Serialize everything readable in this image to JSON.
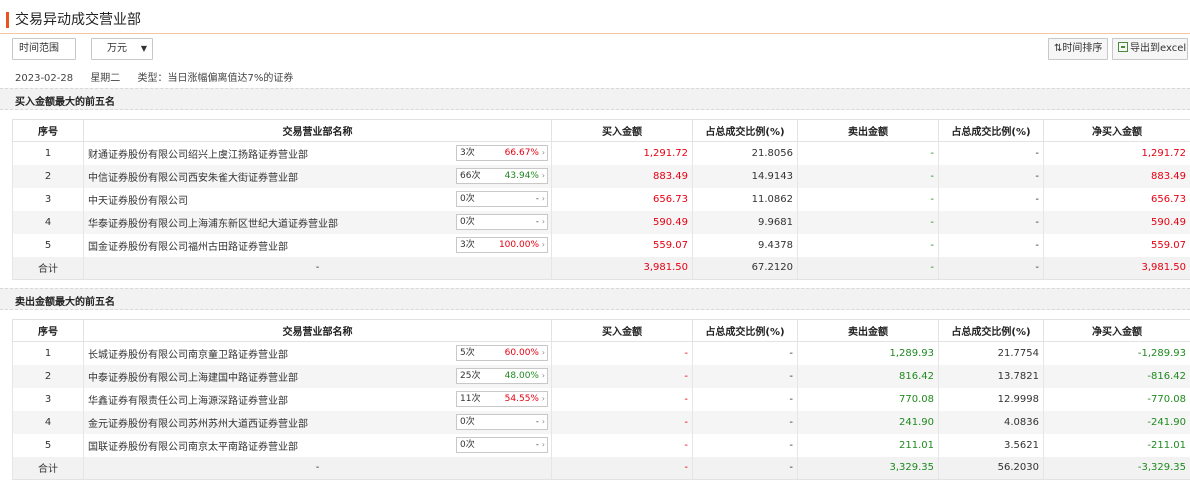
{
  "page": {
    "title": "交易异动成交营业部"
  },
  "toolbar": {
    "range_label": "时间范围",
    "unit_value": "万元",
    "sort_label": "时间排序",
    "export_label": "导出到excel"
  },
  "info": {
    "date": "2023-02-28",
    "weekday": "星期二",
    "type": "类型：当日涨幅偏离值达7%的证券"
  },
  "columns": [
    "序号",
    "交易营业部名称",
    "买入金额",
    "占总成交比例(%)",
    "卖出金额",
    "占总成交比例(%)",
    "净买入金额"
  ],
  "buy_section": {
    "title": "买入金额最大的前五名",
    "rows": [
      {
        "no": "1",
        "name": "财通证券股份有限公司绍兴上虞江扬路证券营业部",
        "count": "3次",
        "pct": "66.67%",
        "pct_color": "red",
        "buy": "1,291.72",
        "buy_ratio": "21.8056",
        "sell": "-",
        "sell_ratio": "-",
        "net": "1,291.72"
      },
      {
        "no": "2",
        "name": "中信证券股份有限公司西安朱雀大街证券营业部",
        "count": "66次",
        "pct": "43.94%",
        "pct_color": "green",
        "buy": "883.49",
        "buy_ratio": "14.9143",
        "sell": "-",
        "sell_ratio": "-",
        "net": "883.49"
      },
      {
        "no": "3",
        "name": "中天证券股份有限公司",
        "count": "0次",
        "pct": "-",
        "pct_color": "gray",
        "buy": "656.73",
        "buy_ratio": "11.0862",
        "sell": "-",
        "sell_ratio": "-",
        "net": "656.73"
      },
      {
        "no": "4",
        "name": "华泰证券股份有限公司上海浦东新区世纪大道证券营业部",
        "count": "0次",
        "pct": "-",
        "pct_color": "gray",
        "buy": "590.49",
        "buy_ratio": "9.9681",
        "sell": "-",
        "sell_ratio": "-",
        "net": "590.49"
      },
      {
        "no": "5",
        "name": "国金证券股份有限公司福州古田路证券营业部",
        "count": "3次",
        "pct": "100.00%",
        "pct_color": "red",
        "buy": "559.07",
        "buy_ratio": "9.4378",
        "sell": "-",
        "sell_ratio": "-",
        "net": "559.07"
      }
    ],
    "total": {
      "label": "合计",
      "name": "-",
      "buy": "3,981.50",
      "buy_ratio": "67.2120",
      "sell": "-",
      "sell_ratio": "-",
      "net": "3,981.50"
    }
  },
  "sell_section": {
    "title": "卖出金额最大的前五名",
    "rows": [
      {
        "no": "1",
        "name": "长城证券股份有限公司南京童卫路证券营业部",
        "count": "5次",
        "pct": "60.00%",
        "pct_color": "red",
        "buy": "-",
        "buy_ratio": "-",
        "sell": "1,289.93",
        "sell_ratio": "21.7754",
        "net": "-1,289.93"
      },
      {
        "no": "2",
        "name": "中泰证券股份有限公司上海建国中路证券营业部",
        "count": "25次",
        "pct": "48.00%",
        "pct_color": "green",
        "buy": "-",
        "buy_ratio": "-",
        "sell": "816.42",
        "sell_ratio": "13.7821",
        "net": "-816.42"
      },
      {
        "no": "3",
        "name": "华鑫证券有限责任公司上海源深路证券营业部",
        "count": "11次",
        "pct": "54.55%",
        "pct_color": "red",
        "buy": "-",
        "buy_ratio": "-",
        "sell": "770.08",
        "sell_ratio": "12.9998",
        "net": "-770.08"
      },
      {
        "no": "4",
        "name": "金元证券股份有限公司苏州苏州大道西证券营业部",
        "count": "0次",
        "pct": "-",
        "pct_color": "gray",
        "buy": "-",
        "buy_ratio": "-",
        "sell": "241.90",
        "sell_ratio": "4.0836",
        "net": "-241.90"
      },
      {
        "no": "5",
        "name": "国联证券股份有限公司南京太平南路证券营业部",
        "count": "0次",
        "pct": "-",
        "pct_color": "gray",
        "buy": "-",
        "buy_ratio": "-",
        "sell": "211.01",
        "sell_ratio": "3.5621",
        "net": "-211.01"
      }
    ],
    "total": {
      "label": "合计",
      "name": "-",
      "buy": "-",
      "buy_ratio": "-",
      "sell": "3,329.35",
      "sell_ratio": "56.2030",
      "net": "-3,329.35"
    }
  },
  "colors": {
    "accent": "#e8541e",
    "up": "#e60012",
    "down": "#1f8a1f"
  }
}
